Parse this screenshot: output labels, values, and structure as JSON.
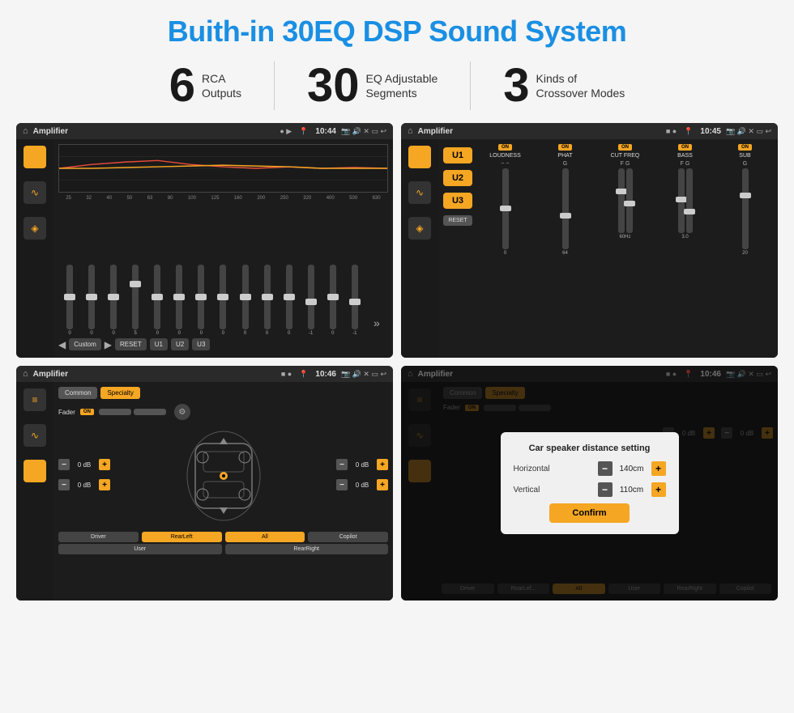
{
  "header": {
    "title": "Buith-in 30EQ DSP Sound System"
  },
  "stats": [
    {
      "number": "6",
      "line1": "RCA",
      "line2": "Outputs"
    },
    {
      "number": "30",
      "line1": "EQ Adjustable",
      "line2": "Segments"
    },
    {
      "number": "3",
      "line1": "Kinds of",
      "line2": "Crossover Modes"
    }
  ],
  "screens": [
    {
      "id": "eq-screen",
      "statusBar": {
        "appName": "Amplifier",
        "time": "10:44"
      },
      "eqFreqs": [
        "25",
        "32",
        "40",
        "50",
        "63",
        "80",
        "100",
        "125",
        "160",
        "200",
        "250",
        "320",
        "400",
        "500",
        "630"
      ],
      "eqValues": [
        "0",
        "0",
        "0",
        "5",
        "0",
        "0",
        "0",
        "0",
        "0",
        "0",
        "0",
        "-1",
        "0",
        "-1"
      ],
      "bottomButtons": [
        "Custom",
        "RESET",
        "U1",
        "U2",
        "U3"
      ]
    },
    {
      "id": "crossover-screen",
      "statusBar": {
        "appName": "Amplifier",
        "time": "10:45"
      },
      "uButtons": [
        "U1",
        "U2",
        "U3"
      ],
      "channels": [
        {
          "name": "LOUDNESS",
          "on": true
        },
        {
          "name": "PHAT",
          "on": true
        },
        {
          "name": "CUT FREQ",
          "on": true
        },
        {
          "name": "BASS",
          "on": true
        },
        {
          "name": "SUB",
          "on": true
        }
      ],
      "resetBtn": "RESET"
    },
    {
      "id": "fader-screen",
      "statusBar": {
        "appName": "Amplifier",
        "time": "10:46"
      },
      "tabs": [
        "Common",
        "Specialty"
      ],
      "faderLabel": "Fader",
      "onToggle": "ON",
      "dbControls": [
        {
          "value": "0 dB"
        },
        {
          "value": "0 dB"
        },
        {
          "value": "0 dB"
        },
        {
          "value": "0 dB"
        }
      ],
      "bottomButtons": [
        "Driver",
        "RearLeft",
        "All",
        "User",
        "RearRight",
        "Copilot"
      ]
    },
    {
      "id": "dialog-screen",
      "statusBar": {
        "appName": "Amplifier",
        "time": "10:46"
      },
      "tabs": [
        "Common",
        "Specialty"
      ],
      "dialog": {
        "title": "Car speaker distance setting",
        "rows": [
          {
            "label": "Horizontal",
            "value": "140cm"
          },
          {
            "label": "Vertical",
            "value": "110cm"
          }
        ],
        "confirmBtn": "Confirm"
      },
      "dbControls": [
        {
          "value": "0 dB"
        },
        {
          "value": "0 dB"
        }
      ],
      "bottomButtons": [
        "Driver",
        "RearLeft",
        "All",
        "User",
        "RearRight",
        "Copilot"
      ]
    }
  ]
}
